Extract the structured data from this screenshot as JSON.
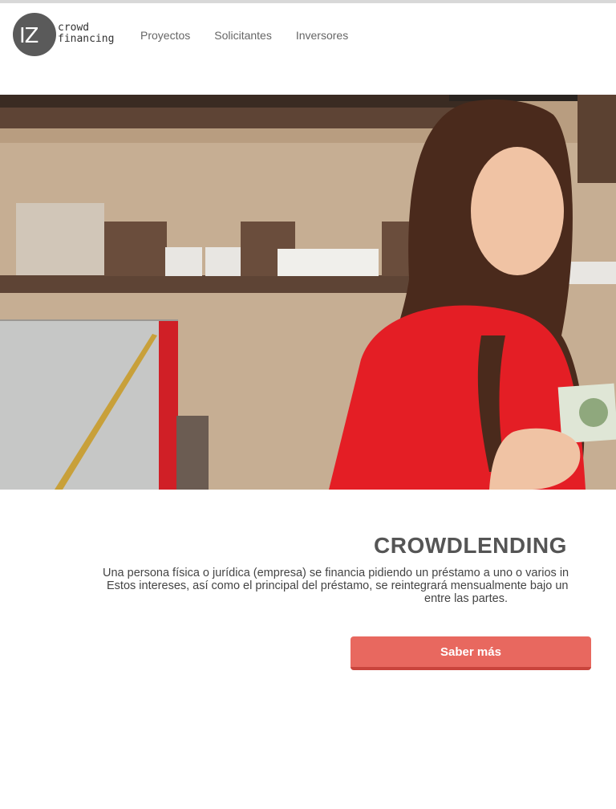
{
  "brand": {
    "monogram": "IZ",
    "line1": "crowd",
    "line2": "financing"
  },
  "nav": {
    "items": [
      "Proyectos",
      "Solicitantes",
      "Inversores"
    ]
  },
  "hero": {
    "image": "woman-holding-banknote-photo"
  },
  "intro": {
    "title": "CROWDLENDING",
    "line1": "Una persona física o jurídica (empresa) se financia pidiendo un préstamo a uno o varios in",
    "line2": "Estos intereses, así como el principal del préstamo, se reintegrará mensualmente bajo un",
    "line3": "entre las partes."
  },
  "cta": {
    "label": "Saber más"
  },
  "colors": {
    "accent": "#e8685f",
    "accent_dark": "#c9443c",
    "logo": "#5a5a5a"
  }
}
